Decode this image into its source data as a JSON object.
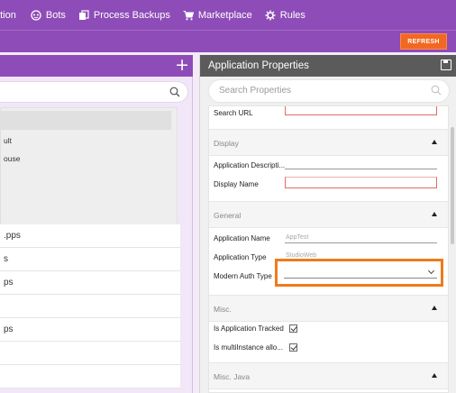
{
  "nav": {
    "items": [
      {
        "label": "ation",
        "icon": "app-icon"
      },
      {
        "label": "Bots",
        "icon": "bot-icon"
      },
      {
        "label": "Process Backups",
        "icon": "process-backup-icon"
      },
      {
        "label": "Marketplace",
        "icon": "cart-icon"
      },
      {
        "label": "Rules",
        "icon": "rules-icon"
      }
    ]
  },
  "toolbar": {
    "refresh_label": "REFRESH",
    "refresh_color": "#f26722"
  },
  "colors": {
    "brand": "#8e4cb8",
    "panel_header": "#5b5b5b",
    "highlight": "#f07a1a"
  },
  "left_panel": {
    "add_icon": "plus-icon",
    "search_icon": "search-icon",
    "tree": [
      "ult",
      "ouse"
    ],
    "list": [
      ".pps",
      "s",
      "ps",
      "",
      "ps",
      "",
      ""
    ]
  },
  "right_panel": {
    "title": "Application Properties",
    "save_icon": "save-icon",
    "search_placeholder": "Search Properties",
    "top_field": {
      "label": "Search URL"
    },
    "sections": [
      {
        "name": "Display"
      },
      {
        "name": "General"
      },
      {
        "name": "Misc."
      },
      {
        "name": "Misc. Java"
      }
    ],
    "display_fields": [
      {
        "label": "Application Descripti..."
      },
      {
        "label": "Display Name"
      }
    ],
    "general_fields": [
      {
        "label": "Application Name",
        "value": "AppTest"
      },
      {
        "label": "Application Type",
        "value": "StudioWeb"
      },
      {
        "label": "Modern Auth Type",
        "value": ""
      }
    ],
    "misc_fields": [
      {
        "label": "Is Application Tracked",
        "checked": true
      },
      {
        "label": "Is multiInstance allo...",
        "checked": true
      }
    ]
  }
}
